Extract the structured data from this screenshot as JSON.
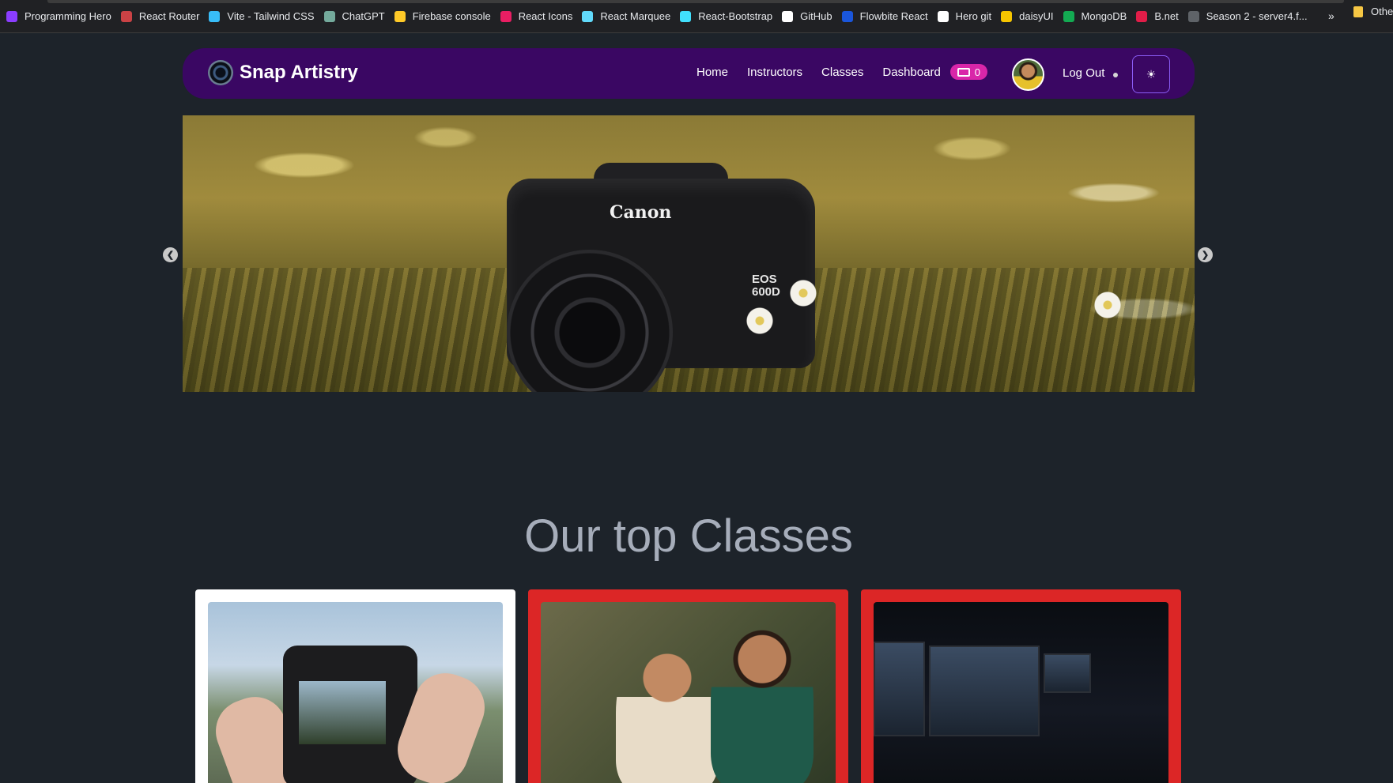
{
  "bookmarks": [
    {
      "label": "Programming Hero",
      "icon": "programming-hero-icon",
      "color": "#8b3dff"
    },
    {
      "label": "React Router",
      "icon": "react-router-icon",
      "color": "#ca4245"
    },
    {
      "label": "Vite - Tailwind CSS",
      "icon": "tailwind-icon",
      "color": "#38bdf8"
    },
    {
      "label": "ChatGPT",
      "icon": "chatgpt-icon",
      "color": "#74aa9c"
    },
    {
      "label": "Firebase console",
      "icon": "firebase-icon",
      "color": "#ffca28"
    },
    {
      "label": "React Icons",
      "icon": "react-icons-icon",
      "color": "#e91e63"
    },
    {
      "label": "React Marquee",
      "icon": "react-icon",
      "color": "#61dafb"
    },
    {
      "label": "React-Bootstrap",
      "icon": "react-bootstrap-icon",
      "color": "#41e0fd"
    },
    {
      "label": "GitHub",
      "icon": "github-icon",
      "color": "#ffffff"
    },
    {
      "label": "Flowbite React",
      "icon": "flowbite-icon",
      "color": "#1a56db"
    },
    {
      "label": "Hero git",
      "icon": "github-icon",
      "color": "#ffffff"
    },
    {
      "label": "daisyUI",
      "icon": "daisyui-icon",
      "color": "#f7c600"
    },
    {
      "label": "MongoDB",
      "icon": "mongodb-icon",
      "color": "#13aa52"
    },
    {
      "label": "B.net",
      "icon": "bnet-icon",
      "color": "#e11d48"
    },
    {
      "label": "Season 2 - server4.f...",
      "icon": "folder-icon",
      "color": "#5f6368"
    }
  ],
  "bookmarks_more": "»",
  "bookmarks_other": "Othe",
  "navbar": {
    "brand": "Snap Artistry",
    "links": [
      "Home",
      "Instructors",
      "Classes",
      "Dashboard"
    ],
    "cart_count": "0",
    "logout": "Log Out",
    "theme_icon": "☀"
  },
  "hero": {
    "camera_brand": "Canon",
    "camera_model_line1": "EOS",
    "camera_model_line2": "600D",
    "prev_arrow": "❮",
    "next_arrow": "❯"
  },
  "section": {
    "title": "Our top Classes"
  },
  "colors": {
    "background": "#1d232a",
    "navbar": "#3a0763",
    "cart_badge": "#d926a9",
    "card_highlight": "#dc2626",
    "title_text": "#a6adba"
  }
}
